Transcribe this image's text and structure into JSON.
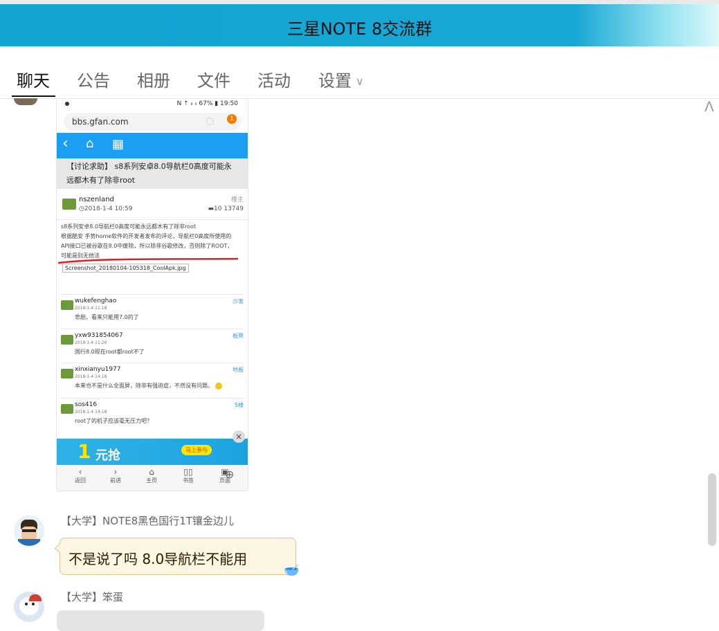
{
  "header": {
    "title": "三星NOTE 8交流群"
  },
  "tabs": [
    {
      "label": "聊天",
      "active": true
    },
    {
      "label": "公告"
    },
    {
      "label": "相册"
    },
    {
      "label": "文件"
    },
    {
      "label": "活动"
    },
    {
      "label": "设置"
    }
  ],
  "phone": {
    "status": "N ⇡ ᵢₗ ᵢₗ 67% ▮ 19:50",
    "url": "bbs.gfan.com",
    "notif_count": "1",
    "thread_title": "【讨论求助】 s8系列安卓8.0导航栏0高度可能永远都木有了除非root",
    "post": {
      "user": "nszenland",
      "date": "2018-1-4 10:59",
      "floor": "楼主",
      "stats": "10 13749",
      "body_line1": "s8系列安卓8.0导航栏0高度可能永远都木有了除非root",
      "body_line2": "根据酷安 手势home软件的开发者发布的评论，导航栏0高度所使用的",
      "body_line3": "API接口已被谷歌在8.0中废除，所以除非谷歌修改，否则除了ROOT，",
      "body_line4": "可能是别无他法",
      "image_name": "Screenshot_20180104-105318_CoolApk.jpg"
    },
    "replies": [
      {
        "user": "wukefenghao",
        "date": "2018-1-4 11:18",
        "text": "悲剧，看来只能用7.0的了",
        "floor": "沙发"
      },
      {
        "user": "yxw931854067",
        "date": "2018-1-4 11:26",
        "text": "国行8.0现在root都root不了",
        "floor": "板凳"
      },
      {
        "user": "xinxianyu1977",
        "date": "2018-1-4 14:18",
        "text": "本来也不是什么全面屏，除非有强迫症，不然没有问题。",
        "floor": "地板"
      },
      {
        "user": "sos416",
        "date": "2018-1-4 14:18",
        "text": "root了的机子应该毫无压力吧？",
        "floor": "5楼"
      }
    ],
    "ad": {
      "big": "1",
      "text": "元抢",
      "cta": "马上参与"
    },
    "bottom_bar": [
      "返回",
      "前进",
      "主页",
      "书签",
      "页面"
    ]
  },
  "messages": [
    {
      "sender": "【大学】NOTE8黑色国行1T镶金边儿",
      "text": "不是说了吗 8.0导航栏不能用"
    },
    {
      "sender": "【大学】笨蛋"
    }
  ]
}
